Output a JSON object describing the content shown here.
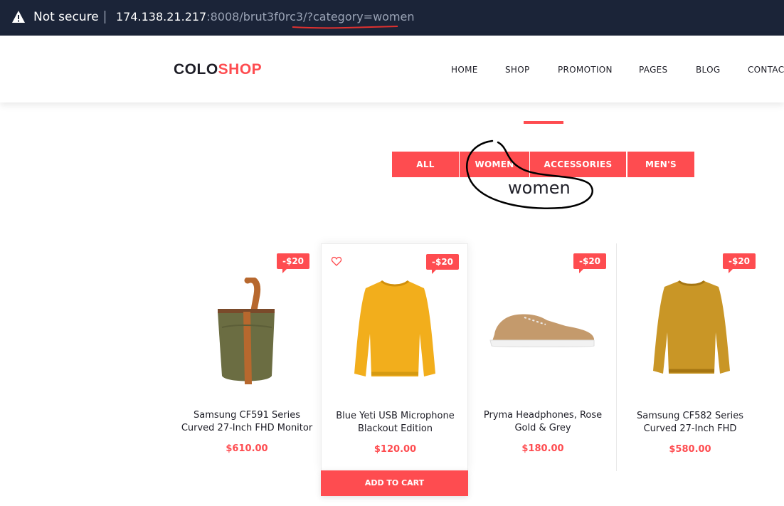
{
  "browser": {
    "security_label": "Not secure",
    "separator": "|",
    "url_host": "174.138.21.217",
    "url_rest": ":8008/brut3f0rc3/?category=women"
  },
  "header": {
    "logo_part1": "COLO",
    "logo_part2": "SHOP",
    "nav": [
      "HOME",
      "SHOP",
      "PROMOTION",
      "PAGES",
      "BLOG",
      "CONTAC"
    ]
  },
  "filters": [
    "ALL",
    "WOMEN",
    "ACCESSORIES",
    "MEN'S"
  ],
  "annotation": "women",
  "products": [
    {
      "badge": "-$20",
      "name_line1": "Samsung CF591 Series",
      "name_line2": "Curved 27-Inch FHD Monitor",
      "price": "$610.00",
      "image": "bag"
    },
    {
      "badge": "-$20",
      "name_line1": "Blue Yeti USB Microphone",
      "name_line2": "Blackout Edition",
      "price": "$120.00",
      "image": "sweater-yellow"
    },
    {
      "badge": "-$20",
      "name_line1": "Pryma Headphones, Rose",
      "name_line2": "Gold & Grey",
      "price": "$180.00",
      "image": "sneaker"
    },
    {
      "badge": "-$20",
      "name_line1": "Samsung CF582 Series",
      "name_line2": "Curved 27-Inch FHD",
      "price": "$580.00",
      "image": "sweater-mustard"
    }
  ],
  "add_to_cart_label": "ADD TO CART",
  "colors": {
    "accent": "#fe4c50",
    "urlbar": "#1b2438",
    "text": "#1e1e27"
  }
}
